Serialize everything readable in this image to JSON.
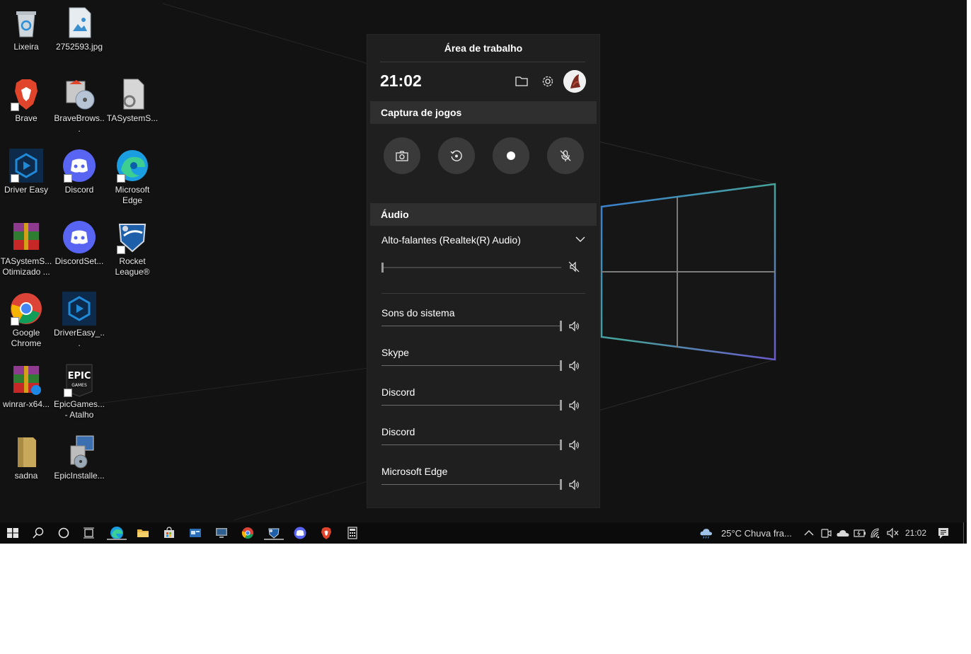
{
  "desktop": {
    "icons": [
      {
        "label": "Lixeira",
        "icon": "recycle-bin-icon"
      },
      {
        "label": "2752593.jpg",
        "icon": "image-file-icon"
      },
      {
        "label": "Brave",
        "icon": "brave-icon"
      },
      {
        "label": "BraveBrows...",
        "icon": "installer-icon"
      },
      {
        "label": "TASystemS...",
        "icon": "settings-file-icon"
      },
      {
        "label": "Driver Easy",
        "icon": "driver-easy-icon"
      },
      {
        "label": "Discord",
        "icon": "discord-icon"
      },
      {
        "label": "Microsoft Edge",
        "icon": "edge-icon"
      },
      {
        "label": "TASystemS... Otimizado ...",
        "icon": "winrar-icon"
      },
      {
        "label": "DiscordSet...",
        "icon": "discord-icon"
      },
      {
        "label": "Rocket League®",
        "icon": "rocket-league-icon"
      },
      {
        "label": "Google Chrome",
        "icon": "chrome-icon"
      },
      {
        "label": "DriverEasy_...",
        "icon": "driver-easy-icon"
      },
      {
        "label": "winrar-x64...",
        "icon": "winrar-icon"
      },
      {
        "label": "EpicGames... - Atalho",
        "icon": "epic-games-icon"
      },
      {
        "label": "sadna",
        "icon": "folder-icon"
      },
      {
        "label": "EpicInstalle...",
        "icon": "installer-icon"
      }
    ]
  },
  "gamebar": {
    "title": "Área de trabalho",
    "clock": "21:02",
    "capture": {
      "heading": "Captura de jogos",
      "buttons": [
        "screenshot-button",
        "record-last-button",
        "record-button",
        "mic-button"
      ]
    },
    "audio": {
      "heading": "Áudio",
      "device": "Alto-falantes (Realtek(R) Audio)",
      "device_volume": 0,
      "apps": [
        {
          "name": "Sons do sistema",
          "volume": 100
        },
        {
          "name": "Skype",
          "volume": 100
        },
        {
          "name": "Discord",
          "volume": 100
        },
        {
          "name": "Discord",
          "volume": 100
        },
        {
          "name": "Microsoft Edge",
          "volume": 100
        }
      ]
    }
  },
  "taskbar": {
    "weather": "25°C  Chuva fra...",
    "time": "21:02"
  },
  "colors": {
    "panel_bg": "#1f1f1f",
    "section_bg": "#2f2f2f",
    "desktop_bg": "#121212",
    "taskbar_bg": "#0b0b0b"
  }
}
